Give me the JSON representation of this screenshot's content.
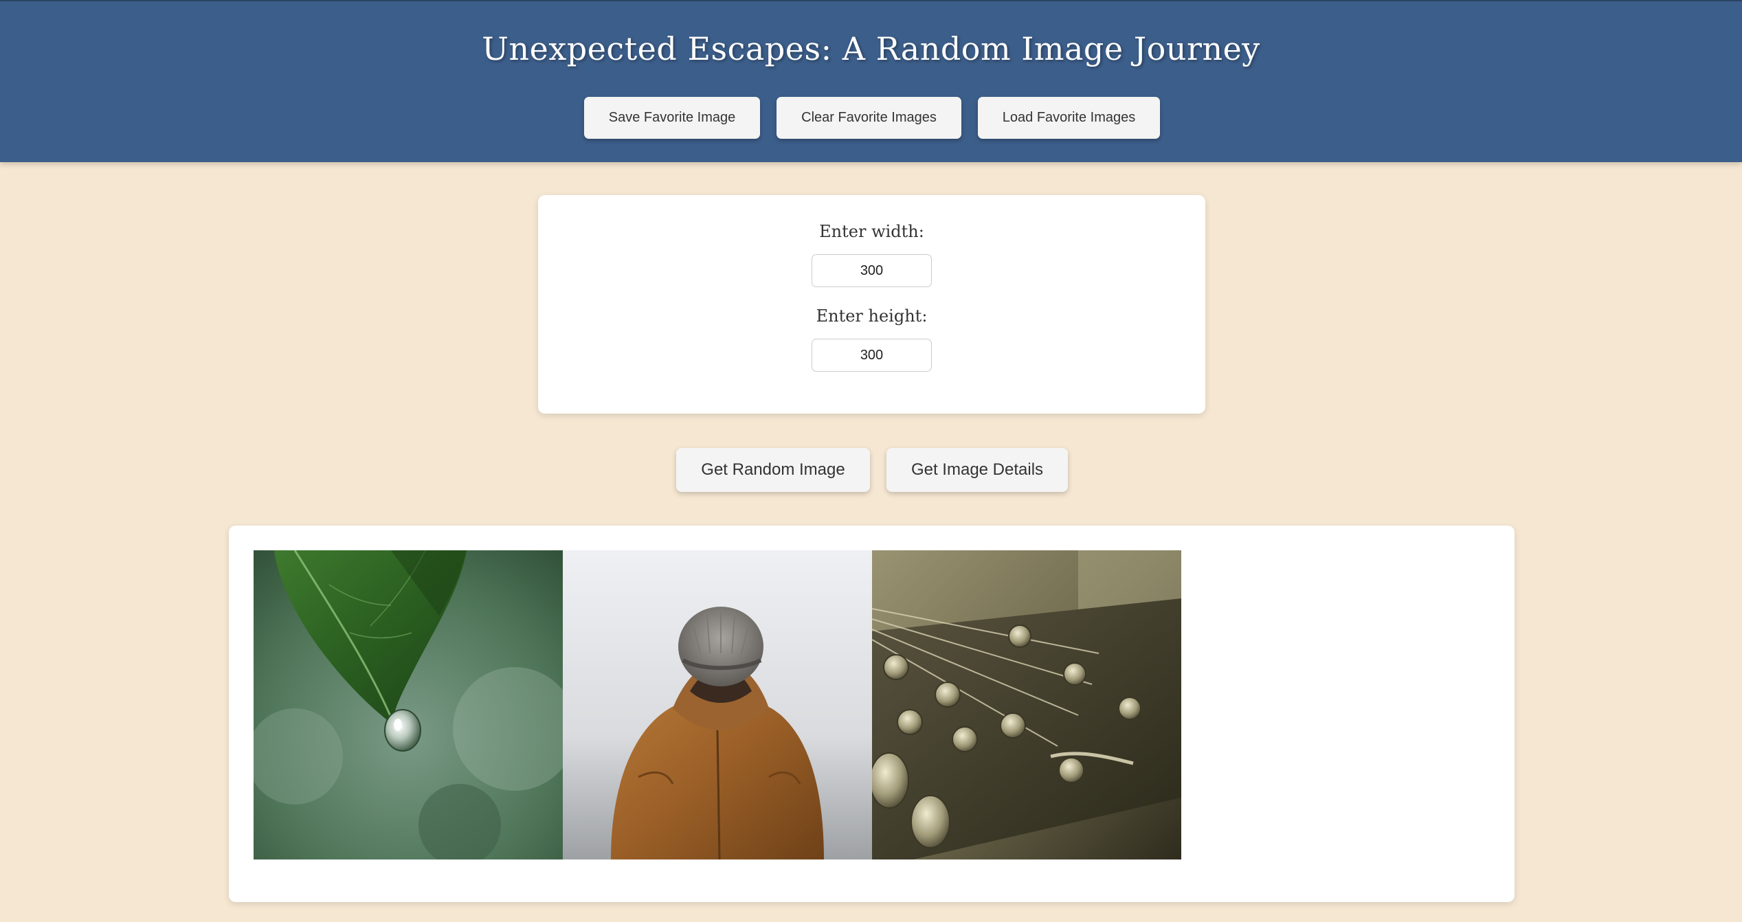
{
  "header": {
    "title": "Unexpected Escapes: A Random Image Journey",
    "buttons": {
      "save": "Save Favorite Image",
      "clear": "Clear Favorite Images",
      "load": "Load Favorite Images"
    }
  },
  "form": {
    "width_label": "Enter width:",
    "width_value": "300",
    "height_label": "Enter height:",
    "height_value": "300"
  },
  "actions": {
    "random": "Get Random Image",
    "details": "Get Image Details"
  },
  "gallery": {
    "images": [
      {
        "icon": "leaf-waterdrop-photo"
      },
      {
        "icon": "person-beanie-jacket-photo"
      },
      {
        "icon": "guitar-headstock-photo"
      }
    ]
  },
  "colors": {
    "header_bg": "#3c5e8a",
    "page_bg": "#f5e7d2"
  }
}
